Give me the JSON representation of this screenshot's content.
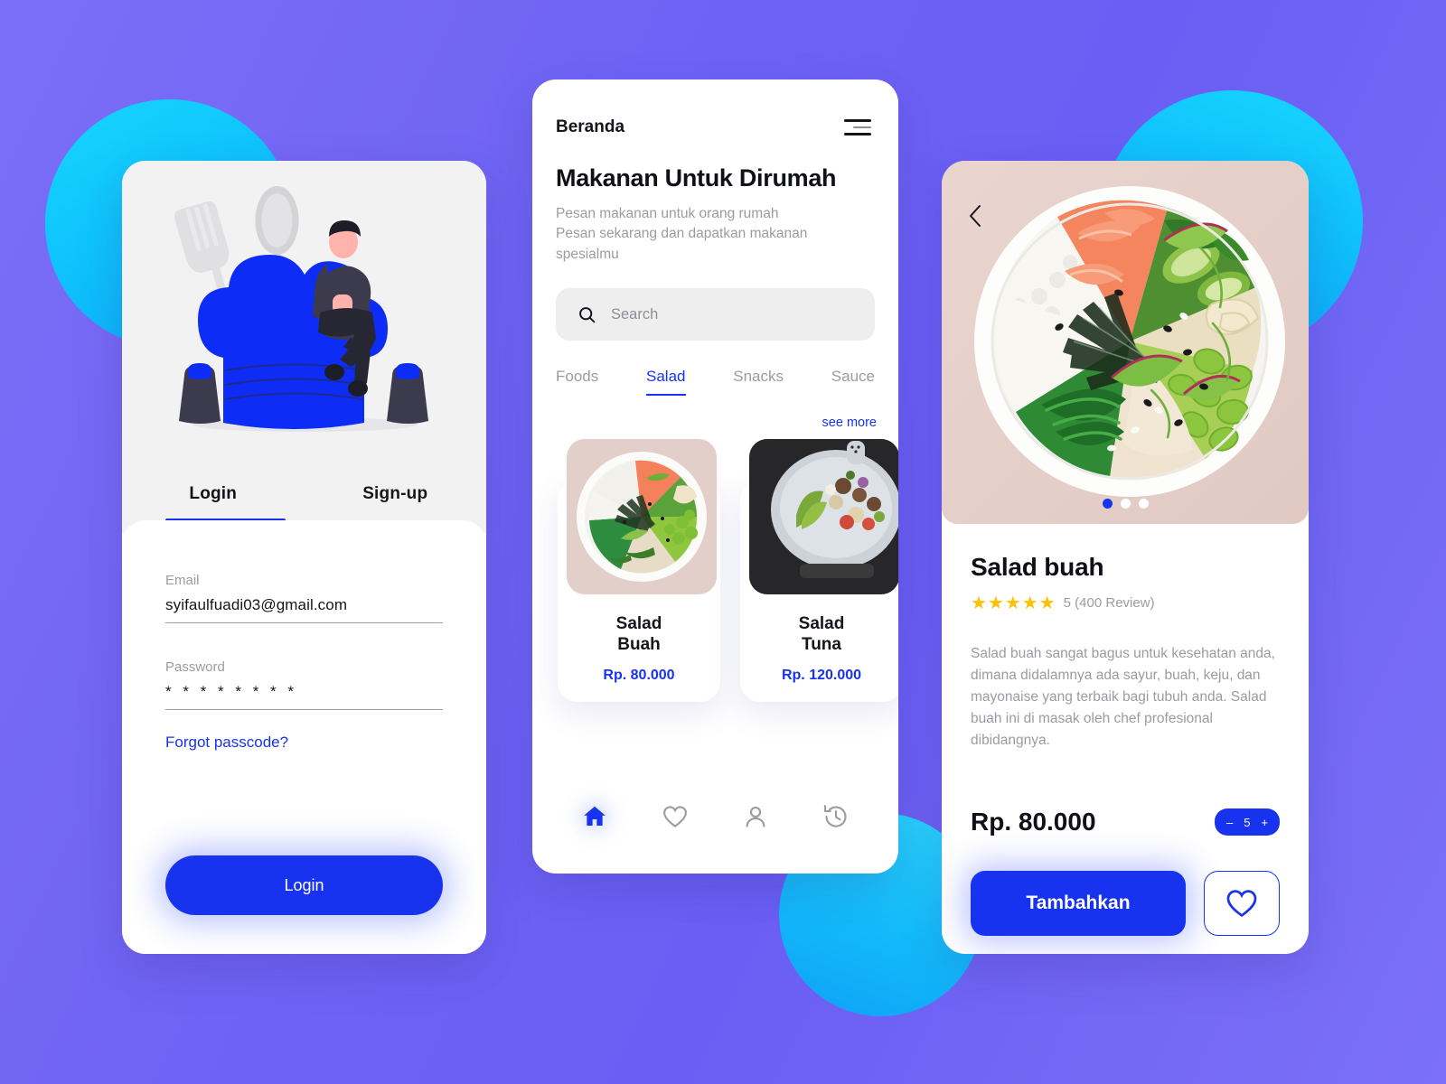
{
  "theme": {
    "accent": "#1833ef",
    "background_gradient_from": "#7b6ef6",
    "background_gradient_to": "#6a5ef4",
    "circle_cyan": "#17d6ff",
    "star_gold": "#ffc107",
    "muted_text": "#9b9ba3"
  },
  "login_screen": {
    "tabs": [
      {
        "label": "Login",
        "active": true
      },
      {
        "label": "Sign-up",
        "active": false
      }
    ],
    "email": {
      "label": "Email",
      "value": "syifaulfuadi03@gmail.com"
    },
    "password": {
      "label": "Password",
      "value": "* * * * * * * *"
    },
    "forgot_link": "Forgot passcode?",
    "submit_button": "Login",
    "illustration": "chef-hat-with-person-illustration"
  },
  "home_screen": {
    "brand": "Beranda",
    "menu_icon": "hamburger-icon",
    "title": "Makanan Untuk Dirumah",
    "subtitle": "Pesan makanan untuk orang rumah\nPesan sekarang dan dapatkan makanan\nspesialmu",
    "search": {
      "placeholder": "Search",
      "icon": "search-icon"
    },
    "category_tabs": [
      {
        "label": "Foods",
        "active": false
      },
      {
        "label": "Salad",
        "active": true
      },
      {
        "label": "Snacks",
        "active": false
      },
      {
        "label": "Sauce",
        "active": false
      }
    ],
    "see_more": "see more",
    "cards": [
      {
        "name": "Salad\nBuah",
        "price": "Rp. 80.000",
        "image": "poke-bowl-salmon-photo"
      },
      {
        "name": "Salad\nTuna",
        "price": "Rp. 120.000",
        "image": "tuna-salad-plate-photo"
      }
    ],
    "bottom_nav": [
      {
        "icon": "home-icon",
        "active": true
      },
      {
        "icon": "heart-icon",
        "active": false
      },
      {
        "icon": "person-icon",
        "active": false
      },
      {
        "icon": "history-icon",
        "active": false
      }
    ]
  },
  "detail_screen": {
    "back_icon": "chevron-left-icon",
    "hero_image": "poke-bowl-salmon-photo",
    "carousel_dots": [
      {
        "active": true
      },
      {
        "active": false
      },
      {
        "active": false
      }
    ],
    "title": "Salad buah",
    "stars": "★★★★★",
    "rating_text": "5 (400 Review)",
    "description": "Salad buah sangat bagus untuk kesehatan anda, dimana didalamnya ada sayur, buah, keju, dan mayonaise yang terbaik bagi tubuh anda. Salad buah ini di masak oleh chef profesional dibidangnya.",
    "price": "Rp. 80.000",
    "stepper": {
      "decrement": "–",
      "quantity": "5",
      "increment": "+"
    },
    "add_button": "Tambahkan",
    "favorite_icon": "heart-icon"
  }
}
